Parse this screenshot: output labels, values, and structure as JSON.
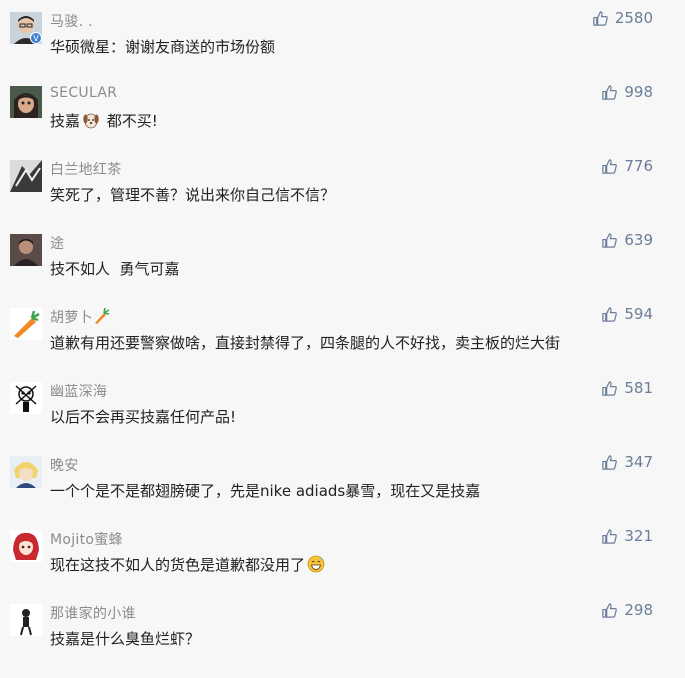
{
  "comments": [
    {
      "name": "马骏. .",
      "text": "华硕微星：谢谢友商送的市场份额",
      "likes": "2580",
      "avatar": "glasses-man-avatar",
      "verified": true
    },
    {
      "name": "SECULAR",
      "text_before": "技嘉",
      "text_after": " 都不买!",
      "emoji": "dog-face-emoji",
      "likes": "998",
      "avatar": "anime-girl-avatar"
    },
    {
      "name": "白兰地红茶",
      "text": "笑死了，管理不善？说出来你自己信不信？",
      "likes": "776",
      "avatar": "bw-photo-avatar"
    },
    {
      "name": "途",
      "text": "技不如人  勇气可嘉",
      "likes": "639",
      "avatar": "dark-figure-avatar"
    },
    {
      "name": "胡萝卜",
      "name_emoji": "carrot-emoji",
      "text": "道歉有用还要警察做啥，直接封禁得了，四条腿的人不好找，卖主板的烂大街",
      "likes": "594",
      "avatar": "carrot-avatar"
    },
    {
      "name": "幽蓝深海",
      "text": "以后不会再买技嘉任何产品!",
      "likes": "581",
      "avatar": "skull-pirate-avatar"
    },
    {
      "name": "晚安",
      "text": "一个个是不是都翅膀硬了，先是nike adiads暴雪，现在又是技嘉",
      "likes": "347",
      "avatar": "blonde-anime-avatar"
    },
    {
      "name": "Mojito蜜蜂",
      "text_before": "现在这技不如人的货色是道歉都没用了",
      "text_after": "",
      "emoji": "grin-sweat-emoji",
      "likes": "321",
      "avatar": "red-hair-anime-avatar"
    },
    {
      "name": "那谁家的小谁",
      "text": "技嘉是什么臭鱼烂虾？",
      "likes": "298",
      "avatar": "small-figure-avatar"
    }
  ],
  "icons": {
    "like": "thumbs-up-icon",
    "verified": "verified-badge-icon"
  },
  "colors": {
    "like": "#6b7e99",
    "name": "#8c8c8c",
    "text": "#222222",
    "background": "#f7f7f7"
  }
}
